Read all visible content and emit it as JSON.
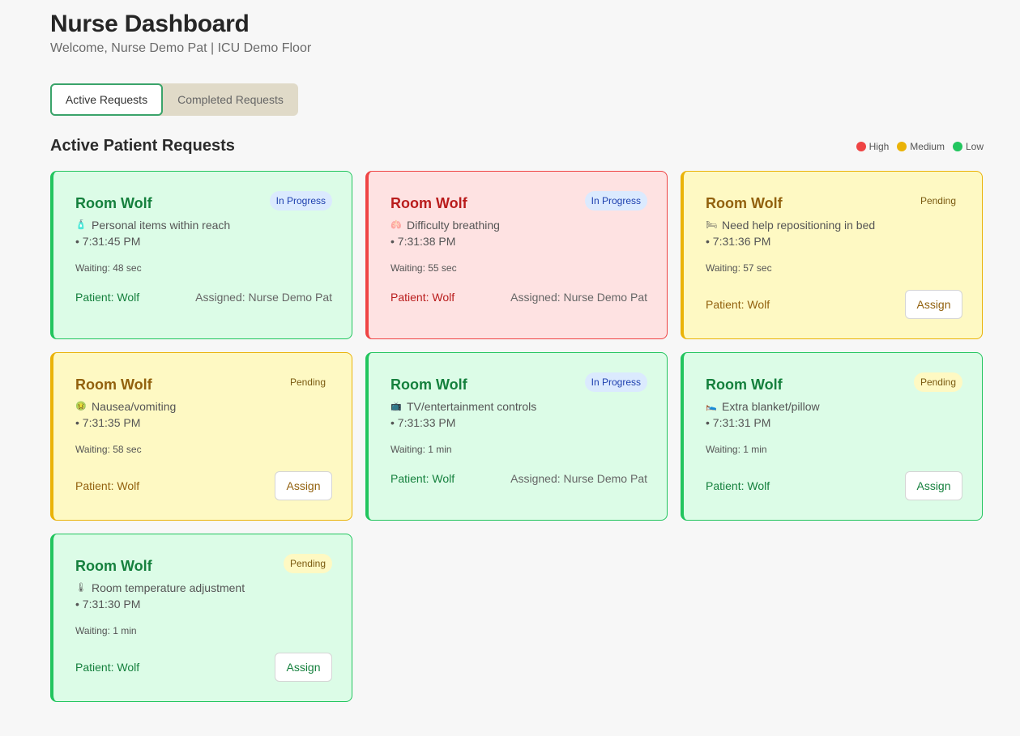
{
  "header": {
    "title": "Nurse Dashboard",
    "subtitle": "Welcome, Nurse Demo Pat | ICU Demo Floor"
  },
  "tabs": [
    {
      "label": "Active Requests",
      "active": true
    },
    {
      "label": "Completed Requests",
      "active": false
    }
  ],
  "section": {
    "title": "Active Patient Requests"
  },
  "legend": [
    {
      "label": "High",
      "color": "#ef4444"
    },
    {
      "label": "Medium",
      "color": "#eab308"
    },
    {
      "label": "Low",
      "color": "#22c55e"
    }
  ],
  "requests": [
    {
      "room": "Room Wolf",
      "status": "In Progress",
      "icon": "🧴",
      "icon_name": "lotion-icon",
      "request": "Personal items within reach",
      "time": "• 7:31:45 PM",
      "waiting": "Waiting: 48 sec",
      "patient": "Patient: Wolf",
      "assigned": "Assigned: Nurse Demo Pat",
      "priority": "low"
    },
    {
      "room": "Room Wolf",
      "status": "In Progress",
      "icon": "🫁",
      "icon_name": "lungs-icon",
      "request": "Difficulty breathing",
      "time": "• 7:31:38 PM",
      "waiting": "Waiting: 55 sec",
      "patient": "Patient: Wolf",
      "assigned": "Assigned: Nurse Demo Pat",
      "priority": "high"
    },
    {
      "room": "Room Wolf",
      "status": "Pending",
      "icon": "🛏",
      "icon_name": "bed-icon",
      "request": "Need help repositioning in bed",
      "time": "• 7:31:36 PM",
      "waiting": "Waiting: 57 sec",
      "patient": "Patient: Wolf",
      "assign_label": "Assign",
      "priority": "medium"
    },
    {
      "room": "Room Wolf",
      "status": "Pending",
      "icon": "🤢",
      "icon_name": "nausea-face-icon",
      "request": "Nausea/vomiting",
      "time": "• 7:31:35 PM",
      "waiting": "Waiting: 58 sec",
      "patient": "Patient: Wolf",
      "assign_label": "Assign",
      "priority": "medium"
    },
    {
      "room": "Room Wolf",
      "status": "In Progress",
      "icon": "📺",
      "icon_name": "tv-icon",
      "request": "TV/entertainment controls",
      "time": "• 7:31:33 PM",
      "waiting": "Waiting: 1 min",
      "patient": "Patient: Wolf",
      "assigned": "Assigned: Nurse Demo Pat",
      "priority": "low"
    },
    {
      "room": "Room Wolf",
      "status": "Pending",
      "icon": "🛌",
      "icon_name": "blanket-icon",
      "request": "Extra blanket/pillow",
      "time": "• 7:31:31 PM",
      "waiting": "Waiting: 1 min",
      "patient": "Patient: Wolf",
      "assign_label": "Assign",
      "priority": "low"
    },
    {
      "room": "Room Wolf",
      "status": "Pending",
      "icon": "🌡",
      "icon_name": "thermometer-icon",
      "request": "Room temperature adjustment",
      "time": "• 7:31:30 PM",
      "waiting": "Waiting: 1 min",
      "patient": "Patient: Wolf",
      "assign_label": "Assign",
      "priority": "low"
    }
  ]
}
